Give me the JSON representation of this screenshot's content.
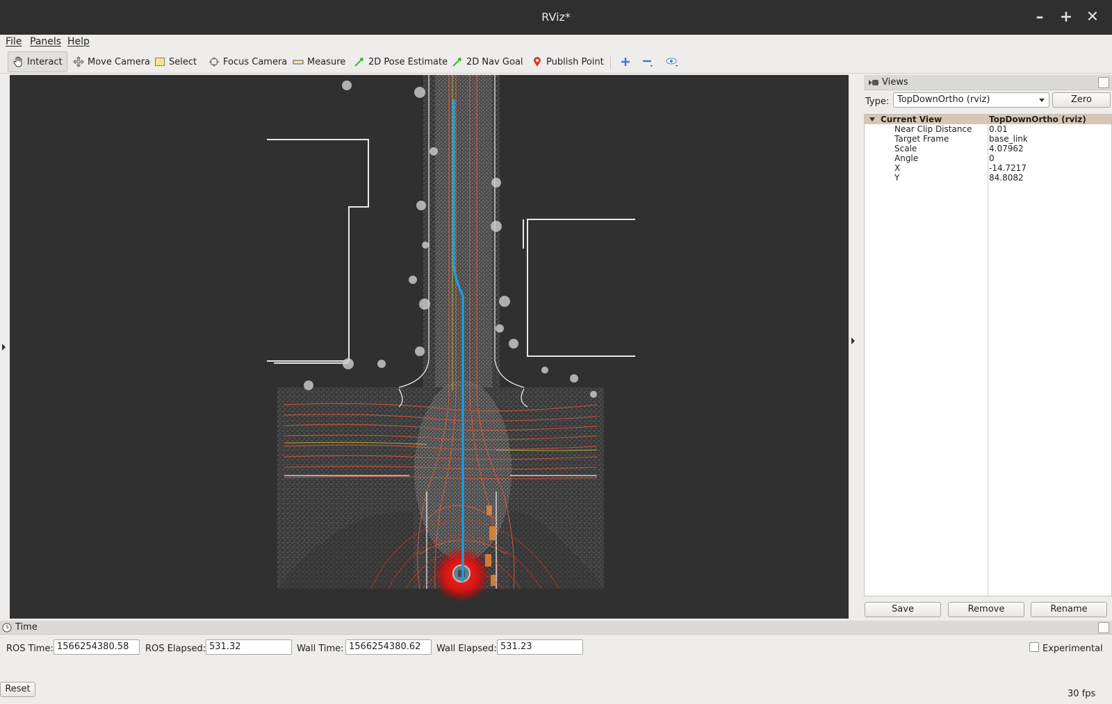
{
  "window": {
    "title": "RViz*"
  },
  "menu": {
    "file": "File",
    "panels": "Panels",
    "help": "Help"
  },
  "toolbar": {
    "interact": "Interact",
    "move_camera": "Move Camera",
    "select": "Select",
    "focus_camera": "Focus Camera",
    "measure": "Measure",
    "pose_estimate": "2D Pose Estimate",
    "nav_goal": "2D Nav Goal",
    "publish_point": "Publish Point"
  },
  "views": {
    "title": "Views",
    "type_label": "Type:",
    "type_value": "TopDownOrtho (rviz)",
    "zero_label": "Zero",
    "current_view": {
      "key": "Current View",
      "value": "TopDownOrtho (rviz)"
    },
    "properties": [
      {
        "key": "Near Clip Distance",
        "value": "0.01"
      },
      {
        "key": "Target Frame",
        "value": "base_link"
      },
      {
        "key": "Scale",
        "value": "4.07962"
      },
      {
        "key": "Angle",
        "value": "0"
      },
      {
        "key": "X",
        "value": "-14.7217"
      },
      {
        "key": "Y",
        "value": "84.8082"
      }
    ],
    "save_label": "Save",
    "remove_label": "Remove",
    "rename_label": "Rename"
  },
  "time": {
    "title": "Time",
    "ros_time_label": "ROS Time:",
    "ros_time": "1566254380.58",
    "ros_elapsed_label": "ROS Elapsed:",
    "ros_elapsed": "531.32",
    "wall_time_label": "Wall Time:",
    "wall_time": "1566254380.62",
    "wall_elapsed_label": "Wall Elapsed:",
    "wall_elapsed": "531.23",
    "experimental_label": "Experimental",
    "reset_label": "Reset",
    "fps": "30 fps"
  },
  "colors": {
    "path": "#1e9be0",
    "point_cloud": "#d8d8d8",
    "lane_lines": "#e0583a",
    "background": "#303030",
    "highlight_row": "#d8c6b3"
  }
}
